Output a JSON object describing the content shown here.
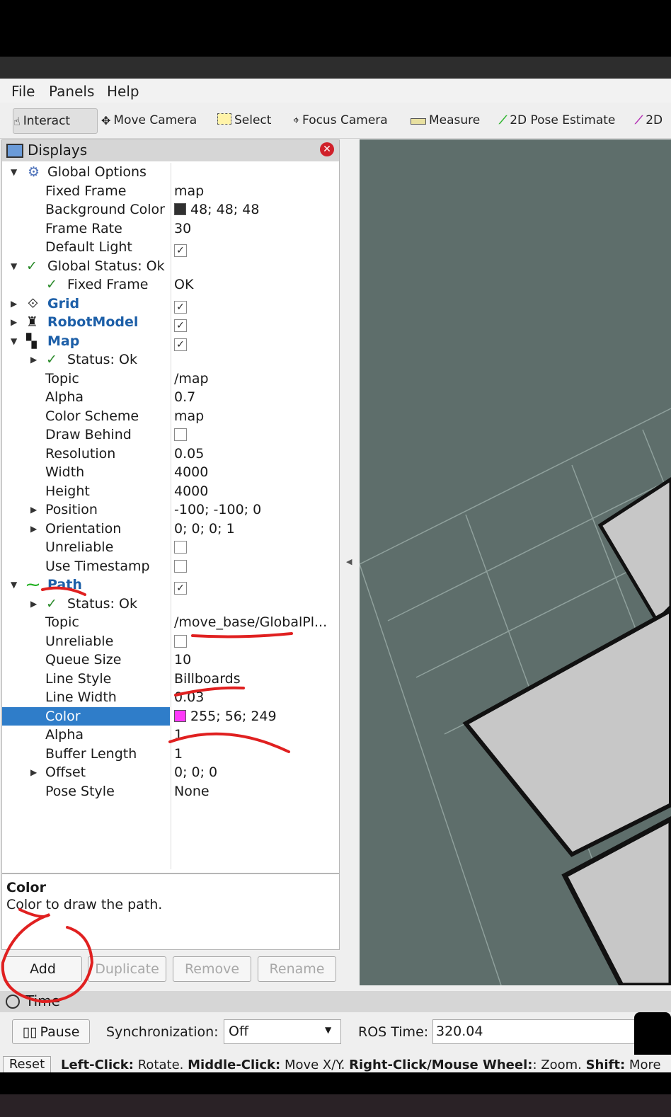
{
  "menu": {
    "file": "File",
    "panels": "Panels",
    "help": "Help"
  },
  "toolbar": {
    "interact": "Interact",
    "move_camera": "Move Camera",
    "select": "Select",
    "focus_camera": "Focus Camera",
    "measure": "Measure",
    "pose_estimate": "2D Pose Estimate",
    "nav_goal_partial": "2D"
  },
  "displays": {
    "title": "Displays",
    "rows": [
      {
        "name": "Global Options",
        "value": ""
      },
      {
        "name": "Fixed Frame",
        "value": "map"
      },
      {
        "name": "Background Color",
        "value": "48; 48; 48"
      },
      {
        "name": "Frame Rate",
        "value": "30"
      },
      {
        "name": "Default Light",
        "value": "✓"
      },
      {
        "name": "Global Status: Ok",
        "value": ""
      },
      {
        "name": "Fixed Frame",
        "value": "OK"
      },
      {
        "name": "Grid",
        "value": "✓"
      },
      {
        "name": "RobotModel",
        "value": "✓"
      },
      {
        "name": "Map",
        "value": "✓"
      },
      {
        "name": "Status: Ok",
        "value": ""
      },
      {
        "name": "Topic",
        "value": "/map"
      },
      {
        "name": "Alpha",
        "value": "0.7"
      },
      {
        "name": "Color Scheme",
        "value": "map"
      },
      {
        "name": "Draw Behind",
        "value": ""
      },
      {
        "name": "Resolution",
        "value": "0.05"
      },
      {
        "name": "Width",
        "value": "4000"
      },
      {
        "name": "Height",
        "value": "4000"
      },
      {
        "name": "Position",
        "value": "-100; -100; 0"
      },
      {
        "name": "Orientation",
        "value": "0; 0; 0; 1"
      },
      {
        "name": "Unreliable",
        "value": ""
      },
      {
        "name": "Use Timestamp",
        "value": ""
      },
      {
        "name": "Path",
        "value": "✓"
      },
      {
        "name": "Status: Ok",
        "value": ""
      },
      {
        "name": "Topic",
        "value": "/move_base/GlobalPl..."
      },
      {
        "name": "Unreliable",
        "value": ""
      },
      {
        "name": "Queue Size",
        "value": "10"
      },
      {
        "name": "Line Style",
        "value": "Billboards"
      },
      {
        "name": "Line Width",
        "value": "0.03"
      },
      {
        "name": "Color",
        "value": "255; 56; 249"
      },
      {
        "name": "Alpha",
        "value": "1"
      },
      {
        "name": "Buffer Length",
        "value": "1"
      },
      {
        "name": "Offset",
        "value": "0; 0; 0"
      },
      {
        "name": "Pose Style",
        "value": "None"
      }
    ]
  },
  "colors": {
    "background_swatch": "#303030",
    "path_color_swatch": "#ff38f9",
    "selection": "#2f7dc9",
    "viewport": "#5e6e6b"
  },
  "description": {
    "title": "Color",
    "text": "Color to draw the path."
  },
  "buttons": {
    "add": "Add",
    "duplicate": "Duplicate",
    "remove": "Remove",
    "rename": "Rename"
  },
  "time": {
    "title": "Time",
    "pause": "Pause",
    "sync_label": "Synchronization:",
    "sync_value": "Off",
    "ros_time_label": "ROS Time:",
    "ros_time_value": "320.04"
  },
  "status_bar": {
    "reset": "Reset",
    "left_click": "Left-Click:",
    "left_click_action": "Rotate.",
    "middle_click": "Middle-Click:",
    "middle_click_action": "Move X/Y.",
    "right_click": "Right-Click/Mouse Wheel:",
    "right_click_action": ": Zoom.",
    "shift": "Shift:",
    "shift_action": "More"
  }
}
